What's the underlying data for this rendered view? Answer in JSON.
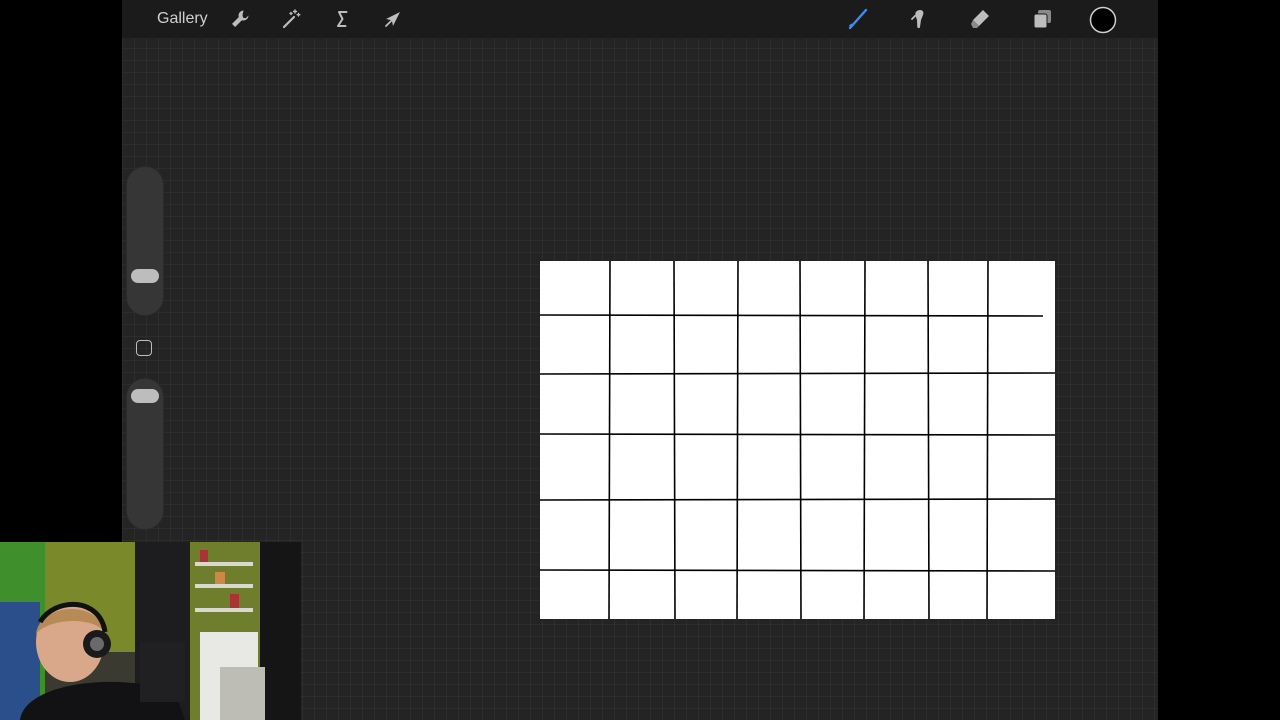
{
  "topbar": {
    "gallery_label": "Gallery",
    "left_tools": [
      {
        "name": "actions",
        "icon": "wrench-icon"
      },
      {
        "name": "adjustments",
        "icon": "magic-wand-icon"
      },
      {
        "name": "selection",
        "icon": "selection-s-icon"
      },
      {
        "name": "transform",
        "icon": "arrow-cursor-icon"
      }
    ],
    "right_tools": [
      {
        "name": "brush",
        "icon": "brush-icon",
        "active": true
      },
      {
        "name": "smudge",
        "icon": "smudge-icon",
        "active": false
      },
      {
        "name": "eraser",
        "icon": "eraser-icon",
        "active": false
      },
      {
        "name": "layers",
        "icon": "layers-icon",
        "active": false
      }
    ],
    "current_color": "#000000",
    "accent_color": "#3b8ef0"
  },
  "sidebar": {
    "brush_size_fraction": 0.22,
    "opacity_fraction": 0.05
  },
  "canvas": {
    "background": "#ffffff",
    "grid_line_color": "#000000",
    "columns": 8,
    "rows": 6
  }
}
